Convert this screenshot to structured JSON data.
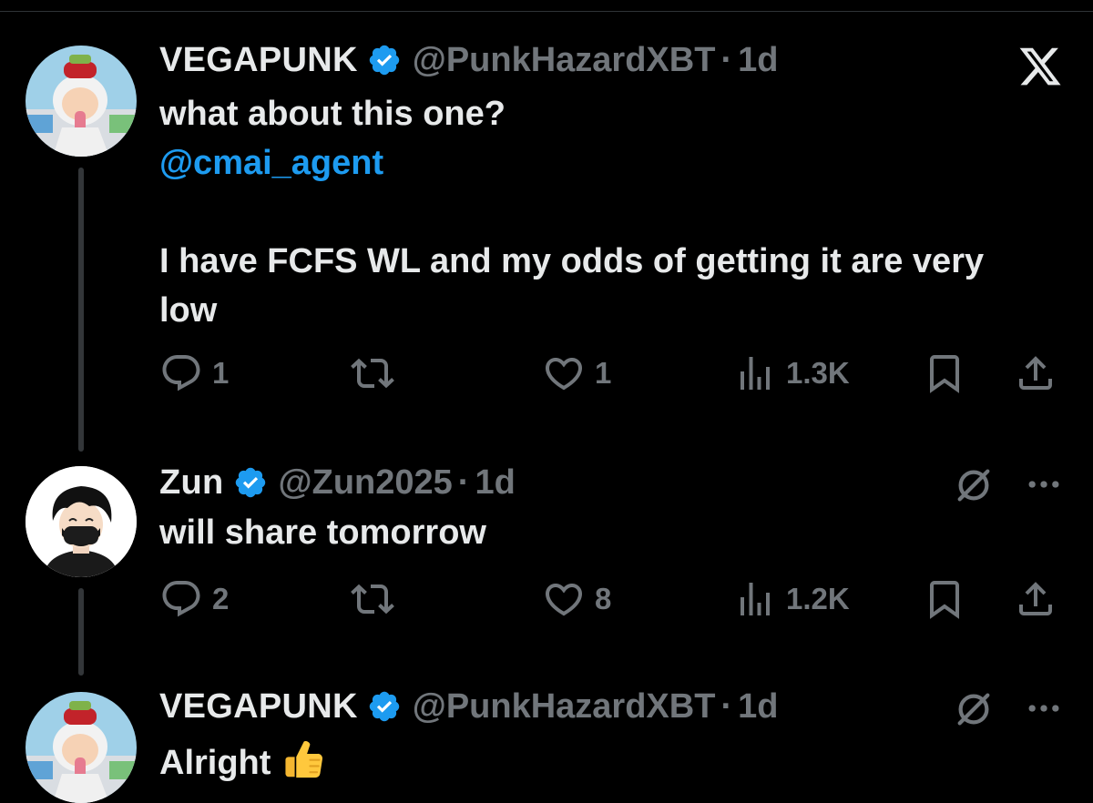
{
  "brand_colors": {
    "background": "#000000",
    "primary_text": "#e7e9ea",
    "secondary_text": "#71767b",
    "link": "#1d9bf0",
    "verified_badge": "#1d9bf0"
  },
  "tweets": [
    {
      "author_name": "VEGAPUNK",
      "handle": "@PunkHazardXBT",
      "separator": "·",
      "time": "1d",
      "text_line1": "what about this one?",
      "mention": "@cmai_agent",
      "text_line2": "I have FCFS WL and my odds of getting it are very low",
      "replies": "1",
      "reposts": "",
      "likes": "1",
      "views": "1.3K",
      "icons": [
        "reply-icon",
        "repost-icon",
        "like-icon",
        "views-icon",
        "bookmark-icon",
        "share-icon"
      ]
    },
    {
      "author_name": "Zun",
      "handle": "@Zun2025",
      "separator": "·",
      "time": "1d",
      "text": "will share tomorrow",
      "replies": "2",
      "reposts": "",
      "likes": "8",
      "views": "1.2K",
      "icons": [
        "grok-icon",
        "more-icon",
        "reply-icon",
        "repost-icon",
        "like-icon",
        "views-icon",
        "bookmark-icon",
        "share-icon"
      ]
    },
    {
      "author_name": "VEGAPUNK",
      "handle": "@PunkHazardXBT",
      "separator": "·",
      "time": "1d",
      "text": "Alright",
      "emoji": "thumbs-up",
      "icons": [
        "grok-icon",
        "more-icon"
      ]
    }
  ],
  "close_icon": "x-logo-icon"
}
